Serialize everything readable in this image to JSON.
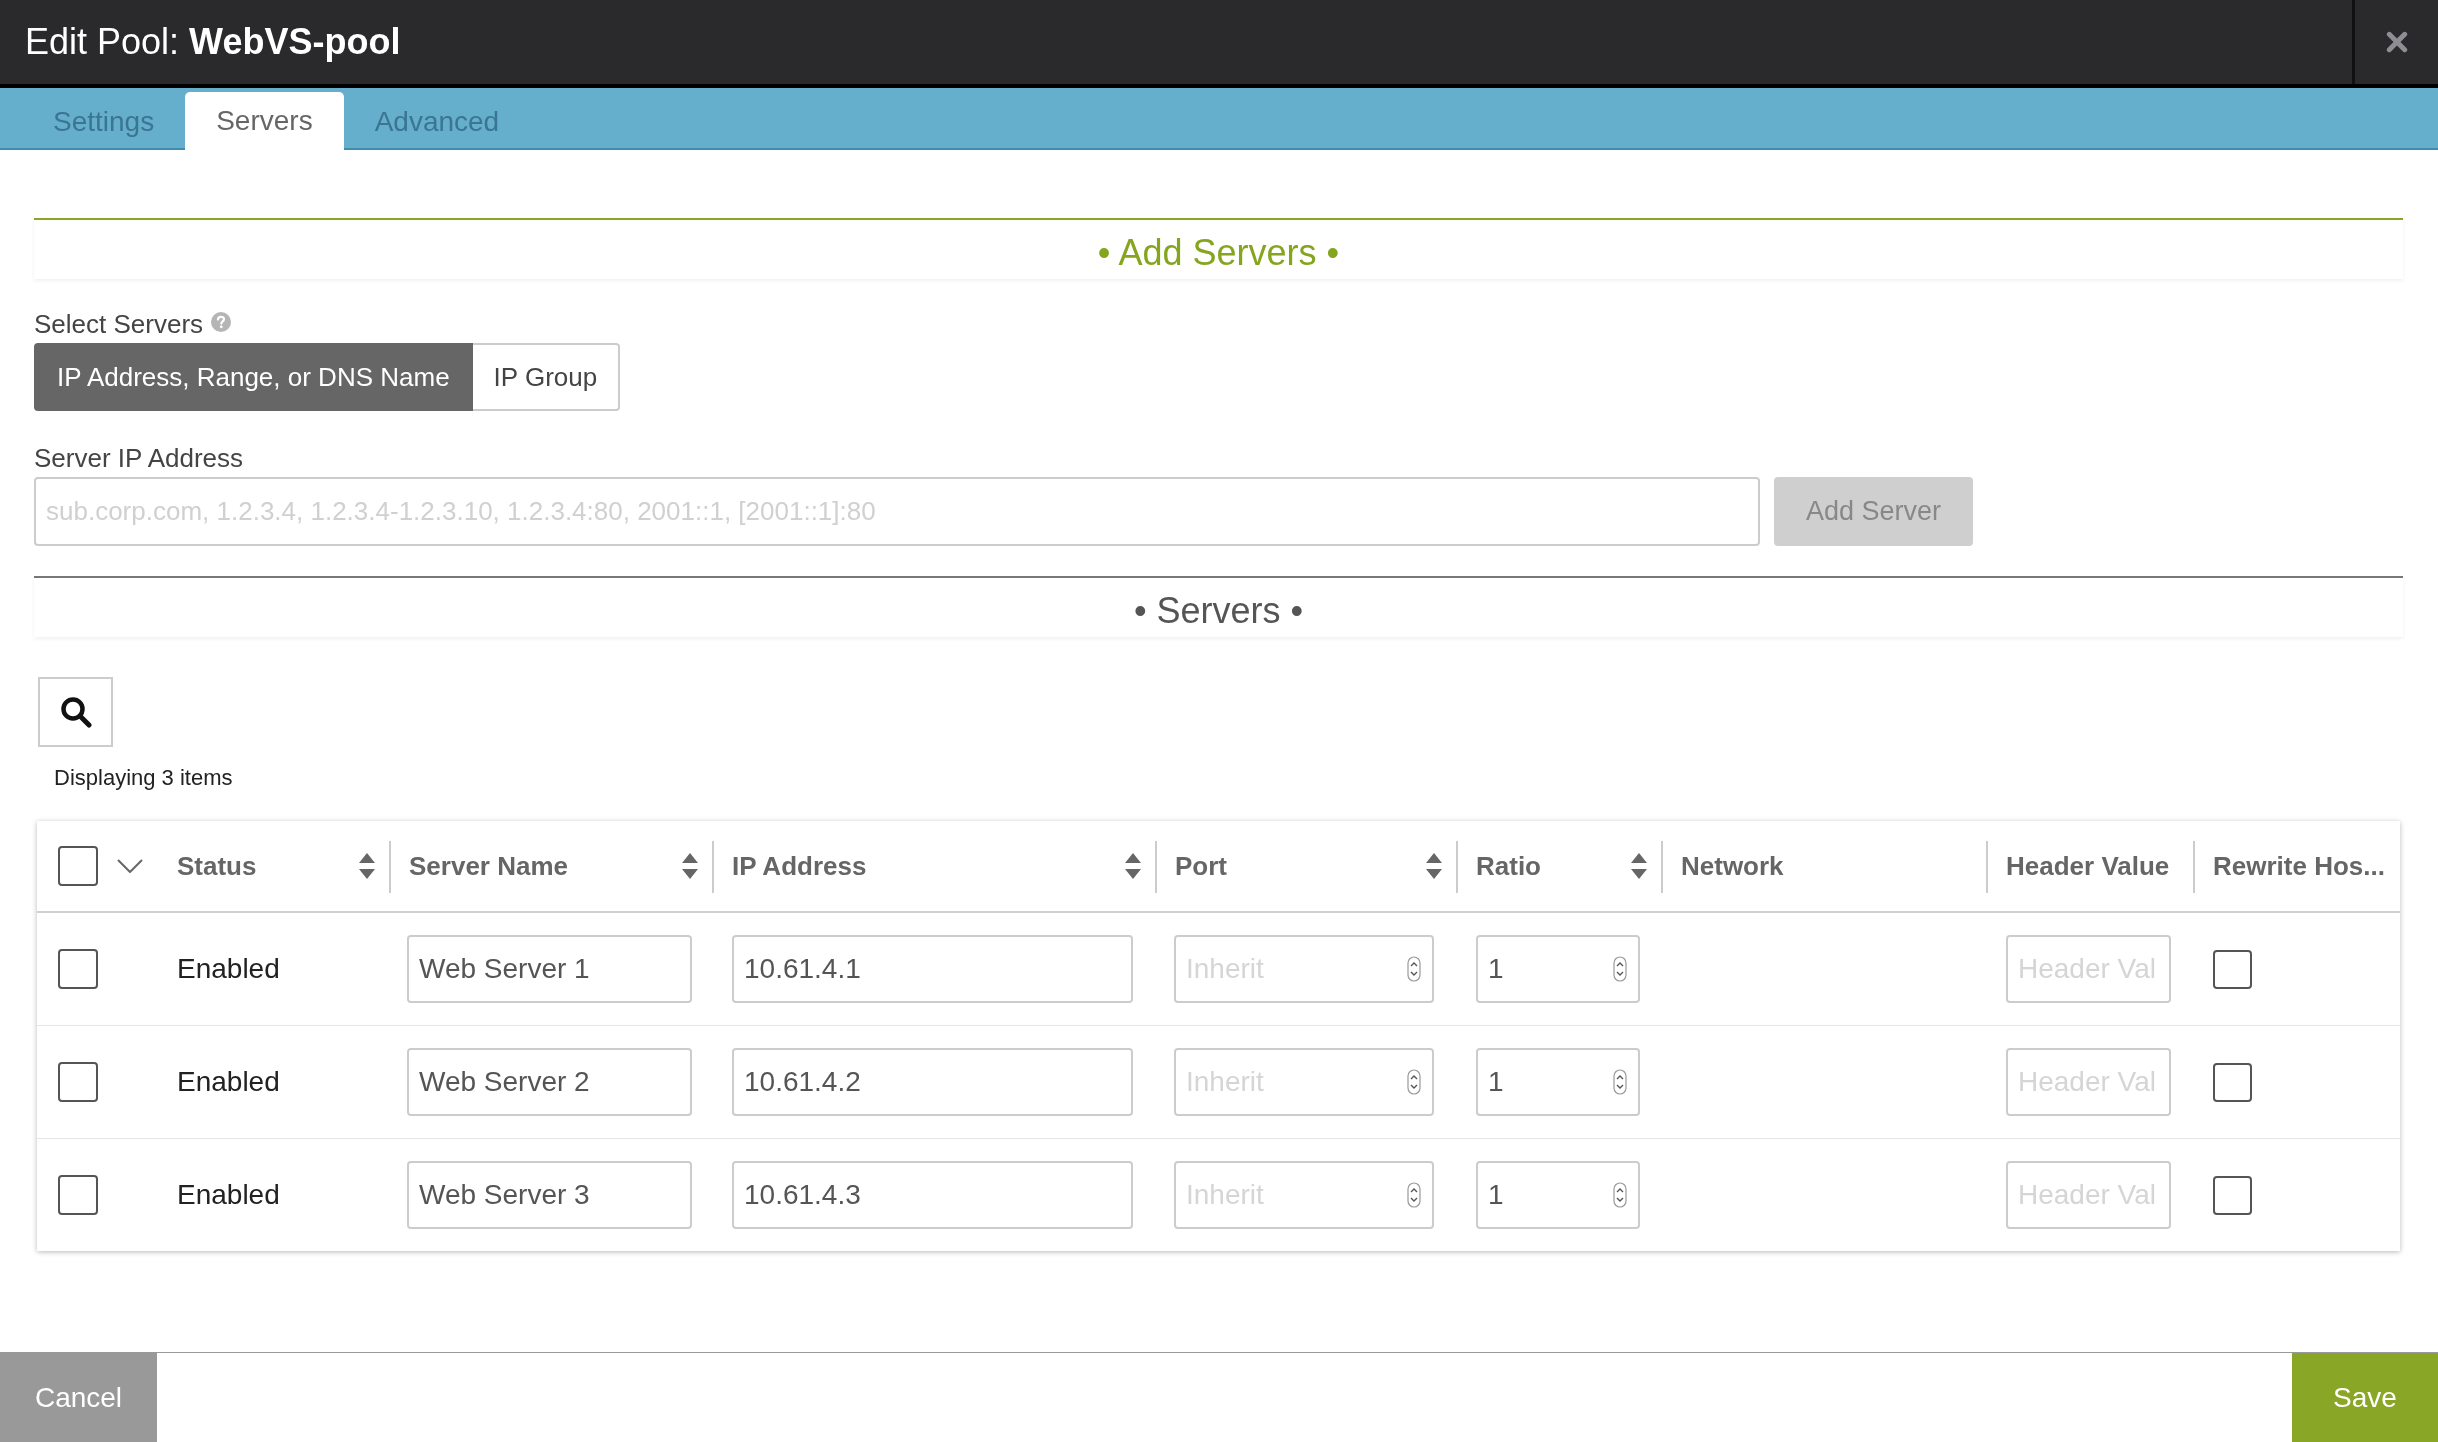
{
  "dialog": {
    "title": "Edit Pool: **WebVS-pool**"
  },
  "tabs": [
    {
      "label": "Settings",
      "selected": false
    },
    {
      "label": "Servers",
      "selected": true
    },
    {
      "label": "Advanced",
      "selected": false
    }
  ],
  "add_servers": {
    "heading": "• Add Servers •",
    "select_label": "Select Servers",
    "modes": [
      {
        "label": "IP Address, Range, or DNS Name",
        "selected": true
      },
      {
        "label": "IP Group",
        "selected": false
      }
    ],
    "address_label": "Server IP Address",
    "address_placeholder": "sub.corp.com, 1.2.3.4, 1.2.3.4-1.2.3.10, 1.2.3.4:80, 2001::1, [2001::1]:80",
    "add_button": {
      "label": "Add Server",
      "disabled": true
    }
  },
  "servers": {
    "heading": "• Servers •",
    "count": "Displaying 3 items",
    "table": {
      "select_all_checked": false,
      "columns": [
        {
          "label": "Status",
          "sortable": true
        },
        {
          "label": "Server Name",
          "sortable": true
        },
        {
          "label": "IP Address",
          "sortable": true
        },
        {
          "label": "Port",
          "sortable": true
        },
        {
          "label": "Ratio",
          "sortable": true
        },
        {
          "label": "Network",
          "sortable": false
        },
        {
          "label": "Header Value",
          "sortable": false
        },
        {
          "label": "Rewrite Hos...",
          "sortable": false
        }
      ],
      "rows": [
        {
          "checked": false,
          "status": "Enabled",
          "server_name": "Web Server 1",
          "ip_address": "10.61.4.1",
          "port": {
            "placeholder": "Inherit"
          },
          "ratio": "1",
          "header_value": {
            "placeholder": "Header Val"
          },
          "rewrite_host": false
        },
        {
          "checked": false,
          "status": "Enabled",
          "server_name": "Web Server 2",
          "ip_address": "10.61.4.2",
          "port": {
            "placeholder": "Inherit"
          },
          "ratio": "1",
          "header_value": {
            "placeholder": "Header Val"
          },
          "rewrite_host": false
        },
        {
          "checked": false,
          "status": "Enabled",
          "server_name": "Web Server 3",
          "ip_address": "10.61.4.3",
          "port": {
            "placeholder": "Inherit"
          },
          "ratio": "1",
          "header_value": {
            "placeholder": "Header Val"
          },
          "rewrite_host": false
        }
      ]
    }
  },
  "footer": {
    "buttons": [
      {
        "label": "Cancel",
        "kind": "cancel"
      },
      {
        "label": "Save",
        "kind": "save"
      }
    ]
  }
}
